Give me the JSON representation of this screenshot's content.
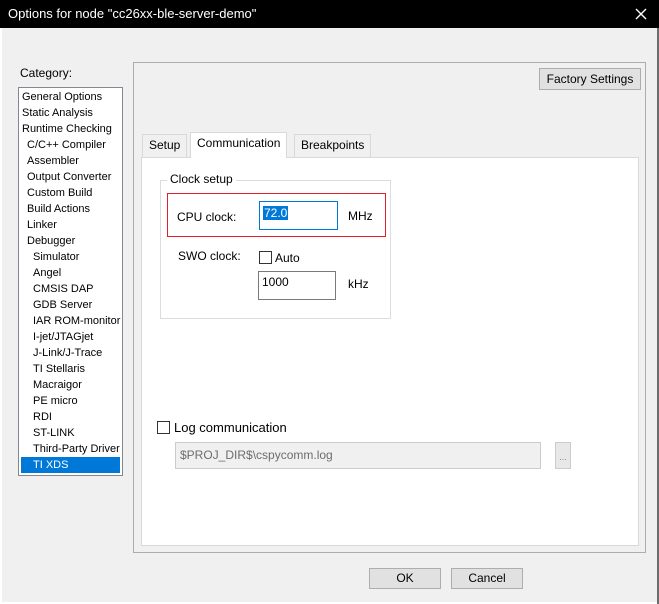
{
  "window": {
    "title": "Options for node \"cc26xx-ble-server-demo\""
  },
  "category": {
    "label": "Category:",
    "items": [
      {
        "label": "General Options"
      },
      {
        "label": "Static Analysis"
      },
      {
        "label": "Runtime Checking"
      },
      {
        "label": "C/C++ Compiler"
      },
      {
        "label": "Assembler"
      },
      {
        "label": "Output Converter"
      },
      {
        "label": "Custom Build"
      },
      {
        "label": "Build Actions"
      },
      {
        "label": "Linker"
      },
      {
        "label": "Debugger"
      },
      {
        "label": "Simulator"
      },
      {
        "label": "Angel"
      },
      {
        "label": "CMSIS DAP"
      },
      {
        "label": "GDB Server"
      },
      {
        "label": "IAR ROM-monitor"
      },
      {
        "label": "I-jet/JTAGjet"
      },
      {
        "label": "J-Link/J-Trace"
      },
      {
        "label": "TI Stellaris"
      },
      {
        "label": "Macraigor"
      },
      {
        "label": "PE micro"
      },
      {
        "label": "RDI"
      },
      {
        "label": "ST-LINK"
      },
      {
        "label": "Third-Party Driver"
      },
      {
        "label": "TI XDS"
      }
    ],
    "selected": "TI XDS"
  },
  "buttons": {
    "factory_settings": "Factory Settings",
    "ok": "OK",
    "cancel": "Cancel",
    "browse": "..."
  },
  "tabs": [
    {
      "label": "Setup"
    },
    {
      "label": "Communication"
    },
    {
      "label": "Breakpoints"
    }
  ],
  "active_tab": "Communication",
  "clock_setup": {
    "group_label": "Clock setup",
    "cpu_clock_label": "CPU clock:",
    "cpu_clock_value": "72.0",
    "cpu_clock_unit": "MHz",
    "swo_clock_label": "SWO clock:",
    "auto_label": "Auto",
    "auto_checked": false,
    "swo_clock_value": "1000",
    "swo_clock_unit": "kHz"
  },
  "log": {
    "label": "Log communication",
    "checked": false,
    "path": "$PROJ_DIR$\\cspycomm.log"
  },
  "colors": {
    "selection": "#0078d7",
    "highlight_border": "#e0212b"
  }
}
